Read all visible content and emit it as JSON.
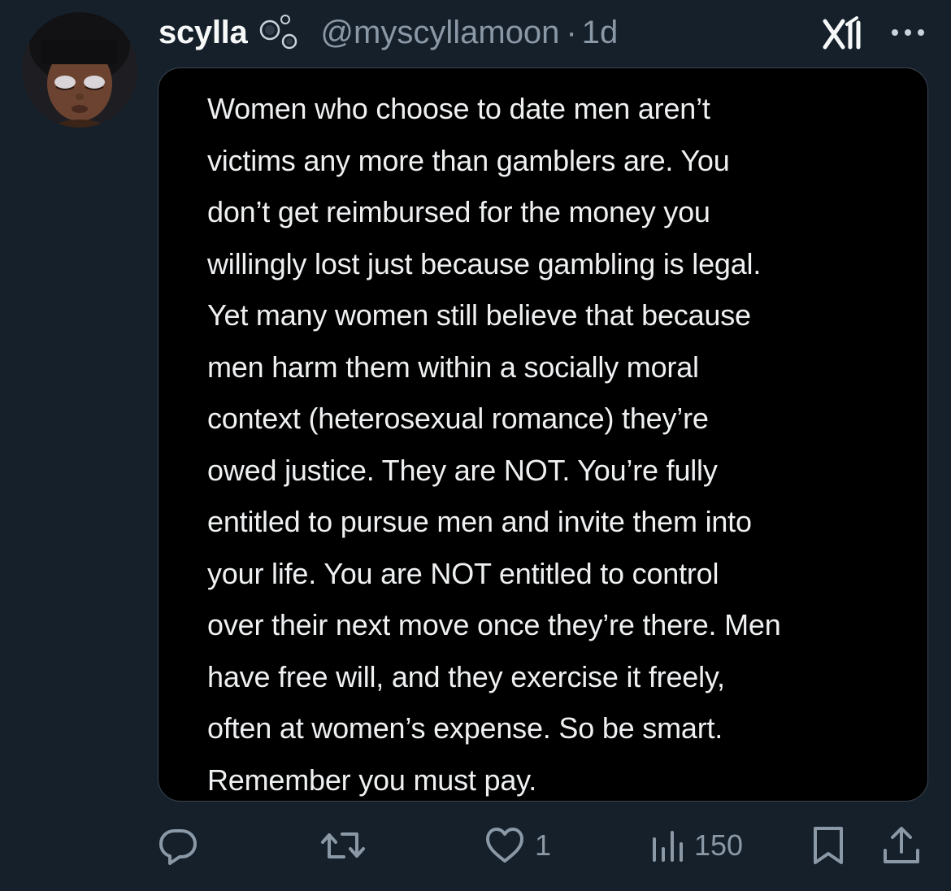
{
  "post": {
    "display_name": "scylla",
    "handle": "@myscyllamoon",
    "separator": "·",
    "time_ago": "1d",
    "image_text": "Women who choose to date men aren’t\nvictims any more than gamblers are. You\ndon’t get reimbursed for the money you\nwillingly lost just because gambling is legal.\nYet many women still believe that because\nmen harm them within a socially moral\ncontext (heterosexual romance) they’re\nowed justice. They are NOT. You’re fully\nentitled to pursue men and invite them into\nyour life. You are NOT entitled to control\nover their next move once they’re there. Men\nhave free will, and they exercise it freely,\noften at women’s expense. So be smart.\nRemember you must pay."
  },
  "actions": {
    "reply_count": "",
    "repost_count": "",
    "like_count": "1",
    "views_count": "150"
  },
  "icons": {
    "avatar": "avatar-image",
    "badge": "bubbles-icon",
    "logo": "x-logo-icon",
    "more": "more-icon",
    "reply": "reply-icon",
    "repost": "repost-icon",
    "like": "heart-icon",
    "views": "views-icon",
    "bookmark": "bookmark-icon",
    "share": "share-icon"
  },
  "colors": {
    "background": "#15202b",
    "muted": "#8b98a5",
    "text": "#e7e9ea"
  }
}
